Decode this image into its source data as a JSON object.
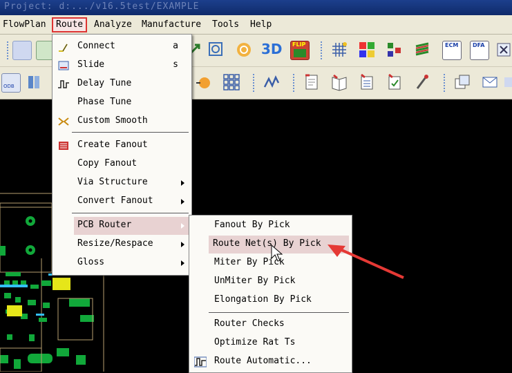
{
  "window": {
    "title": "Project: d:.../v16.5test/EXAMPLE"
  },
  "menubar": {
    "items": [
      {
        "label": "FlowPlan"
      },
      {
        "label": "Route"
      },
      {
        "label": "Analyze"
      },
      {
        "label": "Manufacture"
      },
      {
        "label": "Tools"
      },
      {
        "label": "Help"
      }
    ]
  },
  "toolbar_icons": {
    "flip_text": "FLIP",
    "threed_text": "3D",
    "ecm_text": "ECM",
    "dfa_text": "DFA",
    "odb_text": "ODB"
  },
  "route_menu": {
    "items": [
      {
        "label": "Connect",
        "shortcut": "a"
      },
      {
        "label": "Slide",
        "shortcut": "s"
      },
      {
        "label": "Delay Tune"
      },
      {
        "label": "Phase Tune"
      },
      {
        "label": "Custom Smooth"
      },
      {
        "label": "Create Fanout"
      },
      {
        "label": "Copy Fanout"
      },
      {
        "label": "Via Structure"
      },
      {
        "label": "Convert Fanout"
      },
      {
        "label": "PCB Router"
      },
      {
        "label": "Resize/Respace"
      },
      {
        "label": "Gloss"
      }
    ]
  },
  "pcb_router_submenu": {
    "items": [
      {
        "label": "Fanout By Pick"
      },
      {
        "label": "Route Net(s) By Pick"
      },
      {
        "label": "Miter By Pick"
      },
      {
        "label": "UnMiter By Pick"
      },
      {
        "label": "Elongation By Pick"
      },
      {
        "label": "Router Checks"
      },
      {
        "label": "Optimize Rat Ts"
      },
      {
        "label": "Route Automatic..."
      }
    ]
  },
  "colors": {
    "menubar_bg": "#ece9d8",
    "highlight": "#e8d2d2",
    "annotation_arrow": "#e53935",
    "pcb_green": "#11a83a",
    "pcb_yellow": "#e6e619"
  }
}
